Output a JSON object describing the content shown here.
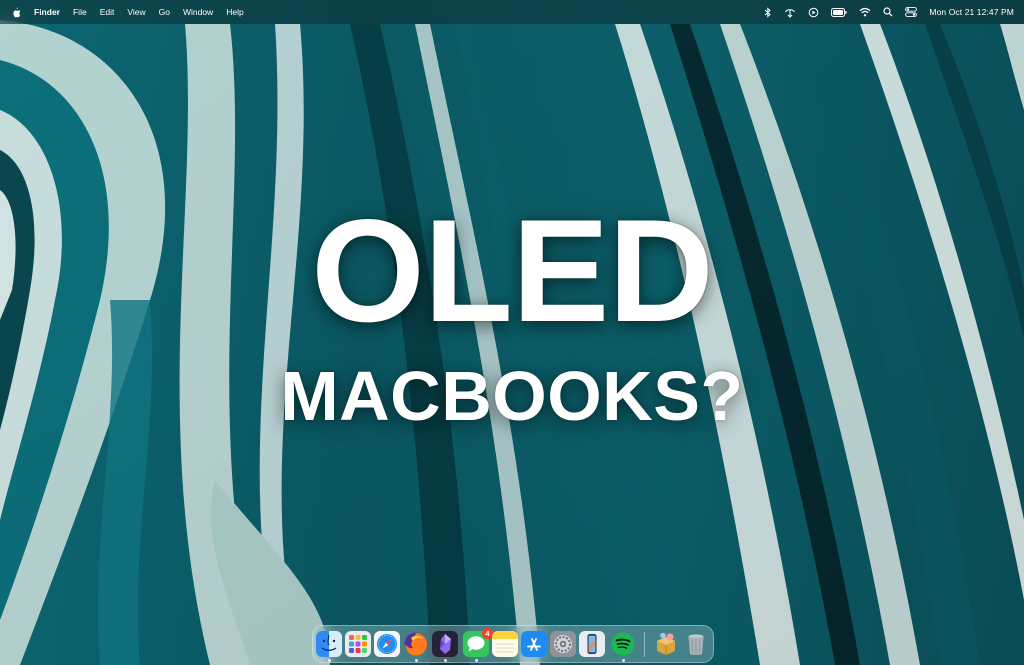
{
  "menubar": {
    "app_name": "Finder",
    "menus": [
      "File",
      "Edit",
      "View",
      "Go",
      "Window",
      "Help"
    ],
    "status_icons": [
      "bluetooth-icon",
      "airdrop-icon",
      "screen-recording-icon",
      "battery-icon",
      "wifi-icon",
      "spotlight-search-icon",
      "control-center-icon"
    ],
    "clock": "Mon Oct 21  12:47 PM"
  },
  "headline": {
    "line1": "OLED",
    "line2": "MACBOOKS?"
  },
  "dock": {
    "apps": [
      {
        "icon": "finder-icon",
        "running": true
      },
      {
        "icon": "launchpad-icon",
        "running": false
      },
      {
        "icon": "safari-icon",
        "running": false
      },
      {
        "icon": "firefox-icon",
        "running": true
      },
      {
        "icon": "obsidian-icon",
        "running": true
      },
      {
        "icon": "messages-icon",
        "running": true,
        "badge": "4"
      },
      {
        "icon": "notes-icon",
        "running": false
      },
      {
        "icon": "app-store-icon",
        "running": false
      },
      {
        "icon": "system-settings-icon",
        "running": false
      },
      {
        "icon": "iphone-mirroring-icon",
        "running": false
      },
      {
        "icon": "spotify-icon",
        "running": true
      },
      {
        "icon": "archive-utility-icon",
        "running": false
      },
      {
        "icon": "trash-icon",
        "running": false
      }
    ]
  },
  "colors": {
    "wallpaper_teal": "#0b5a64",
    "wallpaper_dark": "#052a30",
    "wallpaper_light": "#d8e6e2",
    "messages_green": "#34c759",
    "spotify_green": "#1db954",
    "badge_red": "#ff3b30"
  }
}
